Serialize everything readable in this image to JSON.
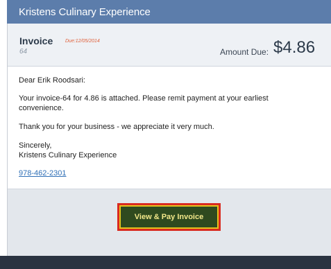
{
  "header": {
    "title": "Kristens Culinary Experience"
  },
  "invoice": {
    "label": "Invoice",
    "due": "Due:12/05/2014",
    "number": "64",
    "amount_label": "Amount Due:",
    "amount_value": "$4.86"
  },
  "message": {
    "greeting": "Dear Erik Roodsari:",
    "main": "Your invoice-64 for 4.86 is attached. Please remit payment at your earliest convenience.",
    "thanks": "Thank you for your business - we appreciate it very much.",
    "sincerely": "Sincerely,",
    "company": "Kristens Culinary Experience",
    "phone": "978-462-2301"
  },
  "actions": {
    "pay_button_label": "View & Pay Invoice"
  },
  "colors": {
    "header_bg": "#5c7dab",
    "button_bg": "#2f4a1f",
    "button_highlight_border": "#d9291f",
    "button_inner_border": "#e6c31d",
    "due_text": "#e0603a",
    "link": "#2f6fb6"
  }
}
